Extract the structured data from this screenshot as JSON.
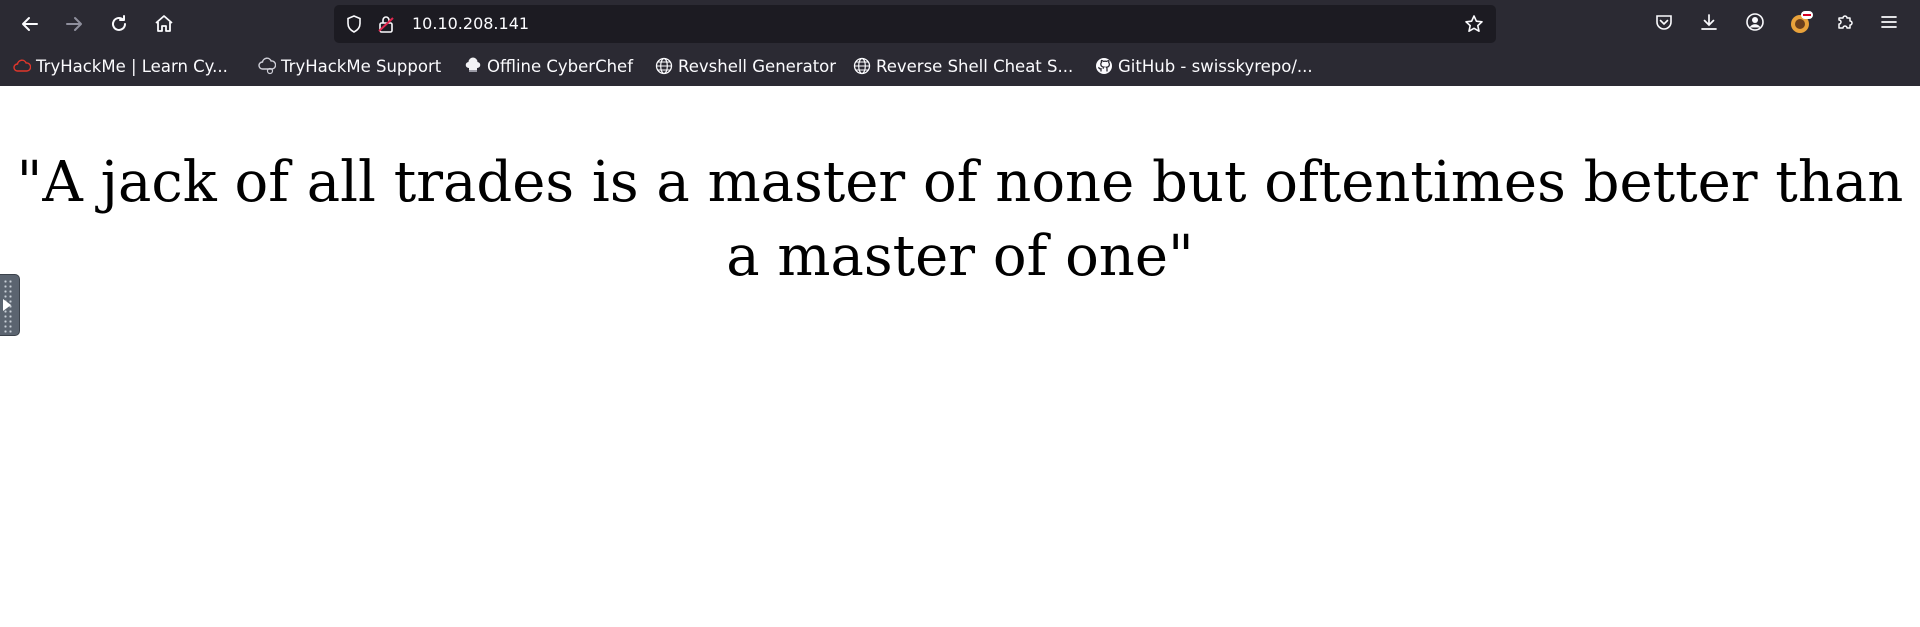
{
  "browser": {
    "url": "10.10.208.141",
    "bookmarks": [
      {
        "label": "TryHackMe | Learn Cy...",
        "icon": "tryhackme-cloud-icon"
      },
      {
        "label": "TryHackMe Support",
        "icon": "support-cloud-icon"
      },
      {
        "label": "Offline CyberChef",
        "icon": "chef-hat-icon"
      },
      {
        "label": "Revshell Generator",
        "icon": "globe-icon"
      },
      {
        "label": "Reverse Shell Cheat S...",
        "icon": "globe-icon"
      },
      {
        "label": "GitHub - swisskyrepo/...",
        "icon": "github-icon"
      }
    ]
  },
  "page": {
    "quote": "\"A jack of all trades is a master of none but oftentimes better than a master of one\""
  },
  "colors": {
    "chrome_bg": "#2b2a33",
    "urlbar_bg": "#1c1b22",
    "tryhackme_red": "#e0362b"
  }
}
